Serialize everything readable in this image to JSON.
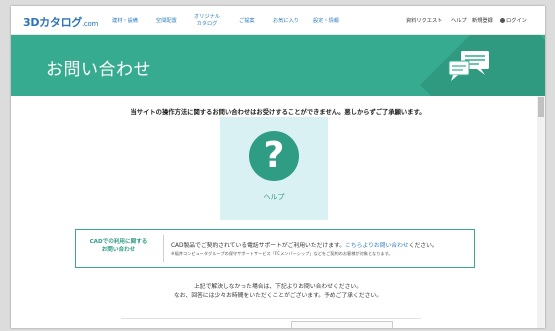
{
  "header": {
    "logo_main": "3Dカタログ",
    "logo_suffix": ".com",
    "nav": [
      {
        "line1": "建材・設備",
        "line2": ""
      },
      {
        "line1": "空間配置",
        "line2": ""
      },
      {
        "line1": "オリジナル",
        "line2": "カタログ"
      },
      {
        "line1": "ご提案",
        "line2": ""
      },
      {
        "line1": "お気に入り",
        "line2": ""
      },
      {
        "line1": "設定・情報",
        "line2": ""
      }
    ],
    "utility": {
      "catalog_request": "資料リクエスト",
      "help": "ヘルプ",
      "register": "新規登録",
      "login": "ログイン"
    }
  },
  "banner": {
    "title": "お問い合わせ",
    "bg_color": "#36ab8f"
  },
  "notice": "当サイトの操作方法に関するお問い合わせはお受けすることができません。悪しからずご了承願います。",
  "help_card": {
    "symbol": "?",
    "label": "ヘルプ"
  },
  "cad": {
    "title_line1": "CADでの利用に関する",
    "title_line2": "お問い合わせ",
    "text_prefix": "CAD製品でご契約されている電話サポートがご利用いただけます。",
    "link": "こちらよりお問い合わせ",
    "text_suffix": "ください。",
    "note": "※福井コンピュータグループの保守サポートサービス「FCメンバーシップ」などをご契約のお客様が対象となります。"
  },
  "bottom": {
    "line1": "上記で解決しなかった場合は、下記よりお問い合わせください。",
    "line2": "なお、回答には少々お時間をいただくことがございます。予めご了承ください。"
  }
}
